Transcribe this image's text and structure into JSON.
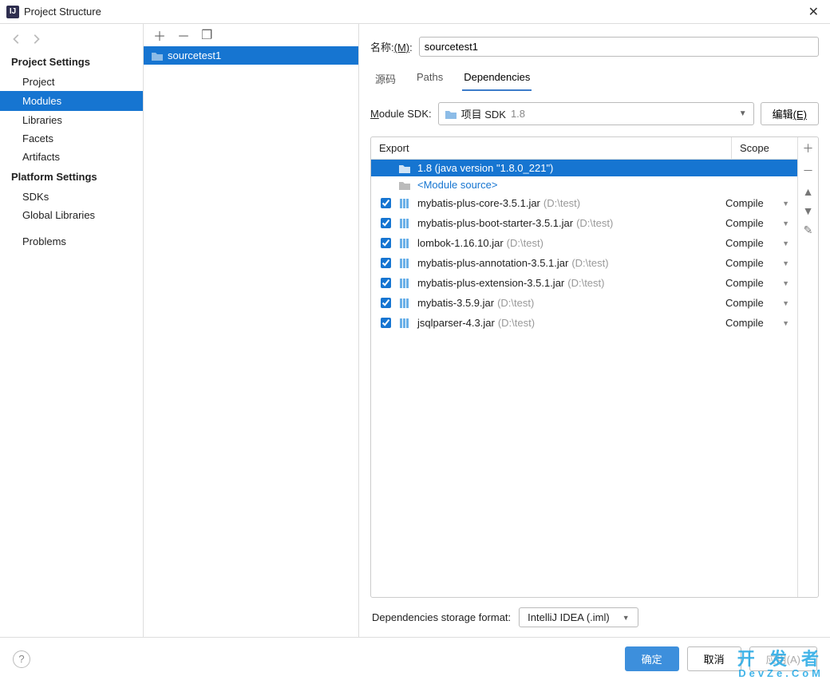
{
  "window": {
    "title": "Project Structure"
  },
  "left_nav": {
    "project_settings": "Project Settings",
    "items_ps": [
      "Project",
      "Modules",
      "Libraries",
      "Facets",
      "Artifacts"
    ],
    "platform_settings": "Platform Settings",
    "items_plat": [
      "SDKs",
      "Global Libraries"
    ],
    "problems": "Problems",
    "selected": "Modules"
  },
  "module_list": {
    "toolbar_icons": [
      "add",
      "remove",
      "copy"
    ],
    "selected_module": "sourcetest1"
  },
  "right": {
    "name_label_prefix": "名称:",
    "name_label_mnemonic": "(M)",
    "name_value": "sourcetest1",
    "tabs": [
      "源码",
      "Paths",
      "Dependencies"
    ],
    "active_tab": "Dependencies",
    "sdk_label": "Module SDK:",
    "sdk_prefix": "项目 SDK",
    "sdk_value": "1.8",
    "edit_label": "编辑",
    "edit_mnemonic": "(E)",
    "dep_header": {
      "export": "Export",
      "scope": "Scope"
    },
    "dep_rows": [
      {
        "checkbox": false,
        "icon": "folder",
        "name": "1.8 (java version \"1.8.0_221\")",
        "path": "",
        "scope": "",
        "selected": true
      },
      {
        "checkbox": false,
        "icon": "folder-grey",
        "name": "<Module source>",
        "path": "",
        "scope": "",
        "module_source": true
      },
      {
        "checkbox": true,
        "icon": "lib",
        "name": "mybatis-plus-core-3.5.1.jar",
        "path": "(D:\\test)",
        "scope": "Compile"
      },
      {
        "checkbox": true,
        "icon": "lib",
        "name": "mybatis-plus-boot-starter-3.5.1.jar",
        "path": "(D:\\test)",
        "scope": "Compile"
      },
      {
        "checkbox": true,
        "icon": "lib",
        "name": "lombok-1.16.10.jar",
        "path": "(D:\\test)",
        "scope": "Compile"
      },
      {
        "checkbox": true,
        "icon": "lib",
        "name": "mybatis-plus-annotation-3.5.1.jar",
        "path": "(D:\\test)",
        "scope": "Compile"
      },
      {
        "checkbox": true,
        "icon": "lib",
        "name": "mybatis-plus-extension-3.5.1.jar",
        "path": "(D:\\test)",
        "scope": "Compile"
      },
      {
        "checkbox": true,
        "icon": "lib",
        "name": "mybatis-3.5.9.jar",
        "path": "(D:\\test)",
        "scope": "Compile"
      },
      {
        "checkbox": true,
        "icon": "lib",
        "name": "jsqlparser-4.3.jar",
        "path": "(D:\\test)",
        "scope": "Compile"
      }
    ],
    "storage_label": "Dependencies storage format:",
    "storage_value": "IntelliJ IDEA (.iml)"
  },
  "footer": {
    "ok": "确定",
    "cancel": "取消",
    "apply": "应用(A)"
  },
  "watermark": {
    "line1": "开 发 者",
    "line2": "DevZe.CoM"
  }
}
